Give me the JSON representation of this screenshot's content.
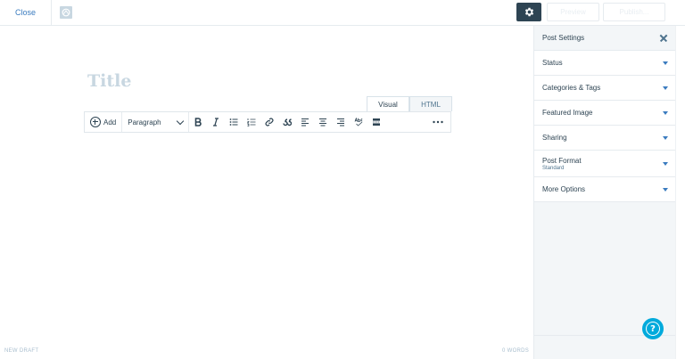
{
  "topbar": {
    "close_label": "Close",
    "preview_label": "Preview",
    "publish_label": "Publish..."
  },
  "editor": {
    "title_placeholder": "Title",
    "tabs": [
      {
        "label": "Visual",
        "active": true
      },
      {
        "label": "HTML",
        "active": false
      }
    ],
    "toolbar": {
      "add_label": "Add",
      "format_value": "Paragraph",
      "buttons": [
        "bold-icon",
        "italic-icon",
        "bullet-list-icon",
        "numbered-list-icon",
        "link-icon",
        "blockquote-icon",
        "align-left-icon",
        "align-center-icon",
        "align-right-icon",
        "spellcheck-icon",
        "more-tag-icon",
        "more-options-icon"
      ]
    }
  },
  "status": {
    "draft_label": "NEW DRAFT",
    "word_count": "0 WORDS"
  },
  "sidebar": {
    "header": "Post Settings",
    "sections": [
      {
        "label": "Status"
      },
      {
        "label": "Categories & Tags"
      },
      {
        "label": "Featured Image"
      },
      {
        "label": "Sharing"
      },
      {
        "label": "Post Format",
        "sub": "Standard"
      },
      {
        "label": "More Options"
      }
    ]
  },
  "colors": {
    "accent": "#3a7bbf",
    "dark": "#2e4453",
    "help": "#00aadc",
    "sidebar_bg": "#f3f6f8"
  }
}
